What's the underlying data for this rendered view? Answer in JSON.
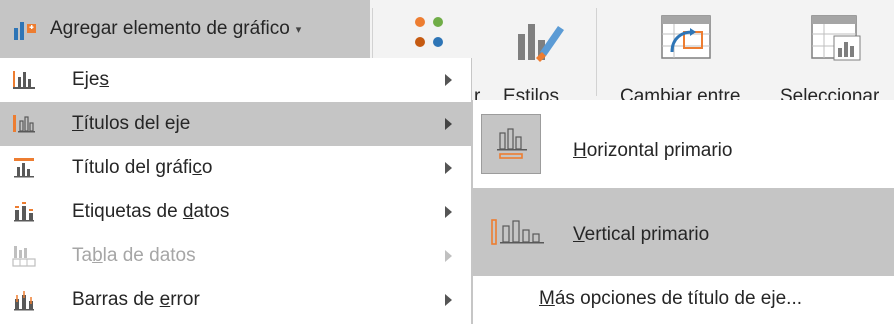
{
  "ribbon": {
    "agregar_button": {
      "label": "Agregar elemento de gráfico",
      "caret": "▾"
    },
    "buttons": [
      {
        "label": "r",
        "icon": "quick-layout-icon"
      },
      {
        "label": "Estilos",
        "icon": "chart-styles-icon"
      },
      {
        "label": "Cambiar entre",
        "icon": "switch-row-column-icon"
      },
      {
        "label": "Seleccionar",
        "icon": "select-data-icon"
      }
    ]
  },
  "menu": {
    "items": [
      {
        "label_pre": "Eje",
        "mnemonic": "s",
        "label_post": "",
        "icon": "axes-icon",
        "state": "normal"
      },
      {
        "label_pre": "",
        "mnemonic": "T",
        "label_post": "ítulos del eje",
        "icon": "axis-titles-icon",
        "state": "active"
      },
      {
        "label_pre": "Título del gráfi",
        "mnemonic": "c",
        "label_post": "o",
        "icon": "chart-title-icon",
        "state": "normal"
      },
      {
        "label_pre": "Etiquetas de ",
        "mnemonic": "d",
        "label_post": "atos",
        "icon": "data-labels-icon",
        "state": "normal"
      },
      {
        "label_pre": "Ta",
        "mnemonic": "b",
        "label_post": "la de datos",
        "icon": "data-table-icon",
        "state": "disabled"
      },
      {
        "label_pre": "Barras de ",
        "mnemonic": "e",
        "label_post": "rror",
        "icon": "error-bars-icon",
        "state": "normal"
      }
    ]
  },
  "submenu": {
    "items": [
      {
        "mnemonic": "H",
        "label_post": "orizontal primario",
        "icon": "primary-horizontal-axis-title-icon"
      },
      {
        "mnemonic": "V",
        "label_post": "ertical primario",
        "icon": "primary-vertical-axis-title-icon"
      }
    ],
    "more": {
      "mnemonic": "M",
      "label_post": "ás opciones de título de eje..."
    }
  },
  "colors": {
    "highlight": "#c5c5c5",
    "accent_orange": "#ed7d31",
    "accent_blue": "#2e75b6",
    "text": "#262626",
    "disabled_text": "#a6a6a6"
  }
}
